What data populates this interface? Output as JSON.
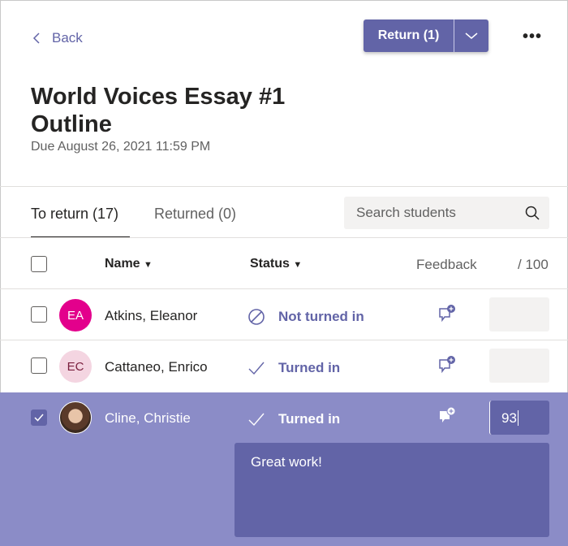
{
  "header": {
    "back_label": "Back",
    "return_label": "Return (1)",
    "more_label": "•••"
  },
  "assignment": {
    "title_line1": "World Voices Essay #1",
    "title_line2": "Outline",
    "due": "Due August 26, 2021 11:59 PM"
  },
  "tabs": [
    {
      "label": "To return (17)",
      "active": true
    },
    {
      "label": "Returned (0)",
      "active": false
    }
  ],
  "search": {
    "placeholder": "Search students"
  },
  "columns": {
    "name": "Name",
    "status": "Status",
    "feedback": "Feedback",
    "points": "/ 100"
  },
  "students": [
    {
      "initials": "EA",
      "name": "Atkins, Eleanor",
      "status": "Not turned in",
      "status_icon": "blocked-icon",
      "grade": "",
      "checked": false,
      "avatar_color": "#e3008c"
    },
    {
      "initials": "EC",
      "name": "Cattaneo, Enrico",
      "status": "Turned in",
      "status_icon": "check-icon",
      "grade": "",
      "checked": false,
      "avatar_color": "#f4d5e1"
    },
    {
      "initials": "",
      "name": "Cline, Christie",
      "status": "Turned in",
      "status_icon": "check-icon",
      "grade": "93",
      "checked": true,
      "avatar": "photo"
    }
  ],
  "feedback_text": "Great work!",
  "colors": {
    "accent": "#6264a7",
    "selected_row": "#8b8cc7"
  }
}
